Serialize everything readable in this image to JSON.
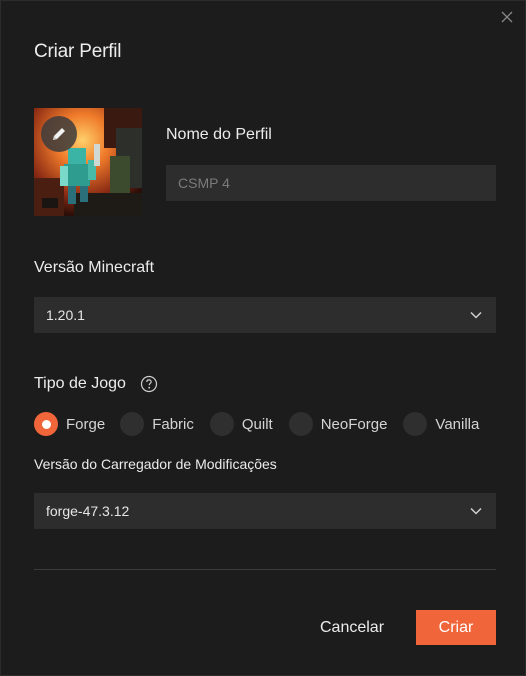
{
  "dialog": {
    "title": "Criar Perfil",
    "close_icon": "close-icon"
  },
  "profile": {
    "edit_icon": "pencil-icon",
    "name_label": "Nome do Perfil",
    "name_placeholder": "CSMP 4",
    "name_value": ""
  },
  "minecraft_version": {
    "label": "Versão Minecraft",
    "selected": "1.20.1",
    "icon": "chevron-down-icon"
  },
  "game_type": {
    "label": "Tipo de Jogo",
    "help_icon": "question-circle-icon",
    "options": [
      {
        "label": "Forge",
        "checked": true
      },
      {
        "label": "Fabric",
        "checked": false
      },
      {
        "label": "Quilt",
        "checked": false
      },
      {
        "label": "NeoForge",
        "checked": false
      },
      {
        "label": "Vanilla",
        "checked": false
      }
    ]
  },
  "loader_version": {
    "label": "Versão do Carregador de Modificações",
    "selected": "forge-47.3.12",
    "icon": "chevron-down-icon"
  },
  "actions": {
    "cancel_label": "Cancelar",
    "create_label": "Criar"
  },
  "colors": {
    "accent": "#f0663a",
    "background": "#1c1c1c",
    "field": "#2d2d2d"
  }
}
